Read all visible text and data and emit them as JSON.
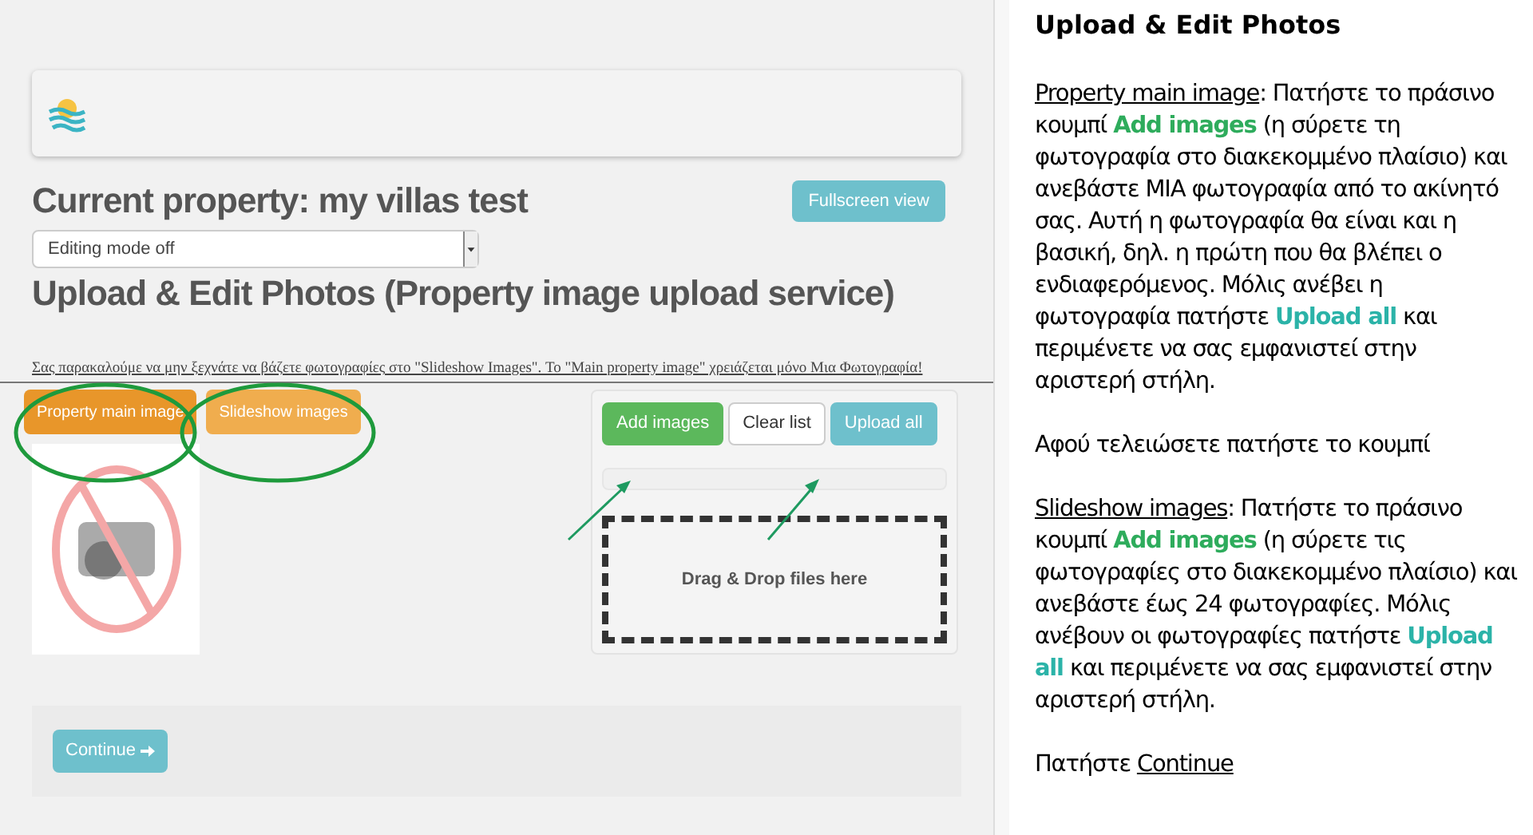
{
  "page": {
    "title": "Current property: my villas test",
    "fullscreen_button": "Fullscreen view",
    "mode_select": {
      "value": "Editing mode off"
    },
    "section_title": "Upload & Edit Photos (Property image upload service)",
    "notice": "Σας παρακαλούμε να μην ξεχνάτε να βάζετε φωτογραφίες στο \"Slideshow Images\". Το \"Main property image\" χρειάζεται μόνο Μια Φωτογραφία!",
    "tabs": [
      {
        "label": "Property main image",
        "selected": true
      },
      {
        "label": "Slideshow images",
        "selected": false
      }
    ],
    "upload_buttons": [
      {
        "label": "Add images",
        "kind": "success"
      },
      {
        "label": "Clear list",
        "kind": "default"
      },
      {
        "label": "Upload all",
        "kind": "info"
      }
    ],
    "progress": {
      "level": 0
    },
    "drop_zone": "Drag & Drop files here",
    "continue_button": "Continue"
  },
  "instructions": {
    "title": "Upload & Edit Photos",
    "paragraphs": [
      [
        {
          "text": "Property main image",
          "kind": "underline"
        },
        {
          "text": ": Πατήστε το πράσινο κουμπί ",
          "kind": "plain"
        },
        {
          "text": "Add images",
          "kind": "green"
        },
        {
          "text": "  (η σύρετε τη φωτογραφία στο διακεκομμένο πλαίσιο) και ανεβάστε ΜΙΑ φωτογραφία από το ακίνητό σας. Αυτή η φωτογραφία θα είναι και η βασική, δηλ. η πρώτη που θα βλέπει ο ενδιαφερόμενος. Μόλις ανέβει η φωτογραφία πατήστε ",
          "kind": "plain"
        },
        {
          "text": "Upload all",
          "kind": "teal"
        },
        {
          "text": " και περιμένετε να σας εμφανιστεί στην αριστερή στήλη.",
          "kind": "plain"
        }
      ],
      [
        {
          "text": "Αφού τελειώσετε πατήστε το κουμπί",
          "kind": "plain"
        }
      ],
      [
        {
          "text": "Slideshow images",
          "kind": "underline"
        },
        {
          "text": ": Πατήστε το πράσινο κουμπί ",
          "kind": "plain"
        },
        {
          "text": "Add images",
          "kind": "green"
        },
        {
          "text": "  (η σύρετε τις φωτογραφίες στο διακεκομμένο πλαίσιο) και ανεβάστε έως 24 φωτογραφίες. Μόλις ανέβουν οι φωτογραφίες πατήστε ",
          "kind": "plain"
        },
        {
          "text": "Upload all",
          "kind": "teal"
        },
        {
          "text": " και περιμένετε να σας εμφανιστεί στην αριστερή στήλη.",
          "kind": "plain"
        }
      ],
      [
        {
          "text": "Πατήστε ",
          "kind": "plain"
        },
        {
          "text": "Continue",
          "kind": "underline"
        }
      ]
    ]
  }
}
